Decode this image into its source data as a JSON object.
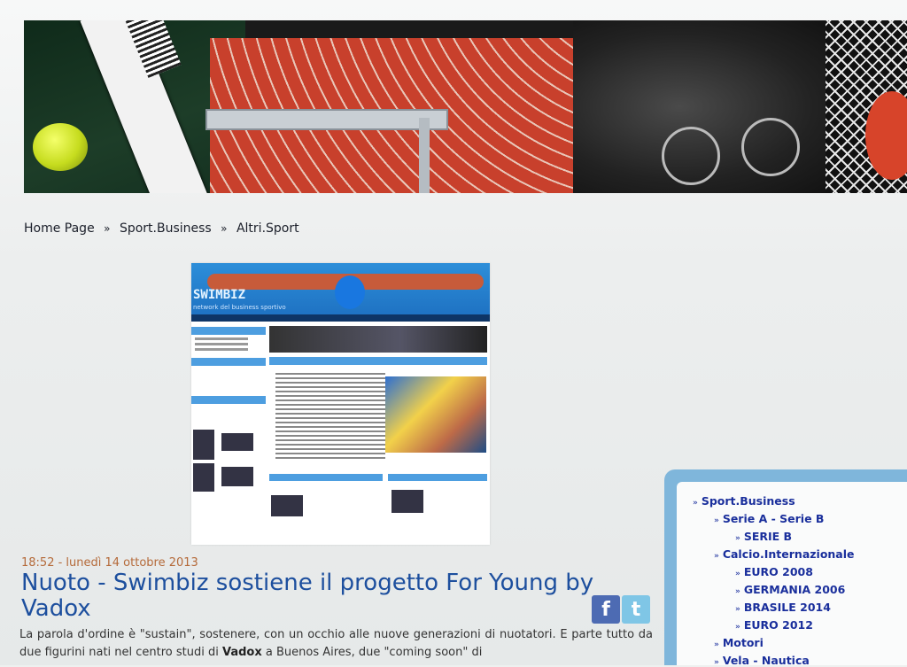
{
  "breadcrumb": {
    "home": "Home Page",
    "sep": "»",
    "level1": "Sport.Business",
    "level2": "Altri.Sport"
  },
  "thumbnail": {
    "brand": "SWIMBIZ",
    "brand_sub": "network del business sportivo"
  },
  "article": {
    "meta": "18:52 - lunedì 14 ottobre 2013",
    "title": "Nuoto - Swimbiz sostiene il progetto For Young by Vadox",
    "excerpt_a": "La parola d'ordine è \"sustain\", sostenere, con un occhio alle nuove generazioni di nuotatori. E parte tutto da due figurini nati nel centro studi di ",
    "excerpt_bold": "Vadox",
    "excerpt_b": " a Buenos Aires, due \"coming soon\" di"
  },
  "social": {
    "facebook": "f",
    "twitter": "t"
  },
  "sidebar": {
    "items": [
      {
        "label": "Sport.Business"
      },
      {
        "label": "Serie A - Serie B"
      },
      {
        "label": "SERIE B"
      },
      {
        "label": "Calcio.Internazionale"
      },
      {
        "label": "EURO 2008"
      },
      {
        "label": "GERMANIA 2006"
      },
      {
        "label": "BRASILE 2014"
      },
      {
        "label": "EURO 2012"
      },
      {
        "label": "Motori"
      },
      {
        "label": "Vela - Nautica"
      }
    ]
  },
  "colors": {
    "link": "#1a2f9c",
    "title": "#1d4f9e",
    "meta": "#b56a3a",
    "sidebar_frame": "#7fb6db"
  }
}
